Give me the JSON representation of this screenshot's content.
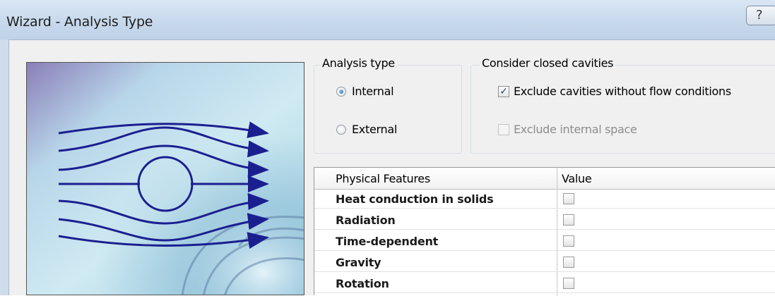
{
  "window": {
    "title": "Wizard - Analysis Type",
    "help_glyph": "?"
  },
  "analysis_type": {
    "label": "Analysis type",
    "options": [
      {
        "label": "Internal",
        "selected": true
      },
      {
        "label": "External",
        "selected": false
      }
    ]
  },
  "cavities": {
    "label": "Consider closed cavities",
    "options": [
      {
        "label": "Exclude cavities without flow conditions",
        "checked": true,
        "enabled": true
      },
      {
        "label": "Exclude internal space",
        "checked": false,
        "enabled": false
      }
    ]
  },
  "features_table": {
    "columns": [
      "Physical Features",
      "Value"
    ],
    "rows": [
      {
        "label": "Heat conduction in solids",
        "checked": false
      },
      {
        "label": "Radiation",
        "checked": false
      },
      {
        "label": "Time-dependent",
        "checked": false
      },
      {
        "label": "Gravity",
        "checked": false
      },
      {
        "label": "Rotation",
        "checked": false
      }
    ]
  },
  "illustration": {
    "icon": "flow-around-cylinder-illustration",
    "stream_color": "#1a1f8f"
  },
  "colors": {
    "title_bar": "#c7d8ec",
    "dialog_bg": "#f0f0f0",
    "check_mark": "#2b4a7a"
  }
}
